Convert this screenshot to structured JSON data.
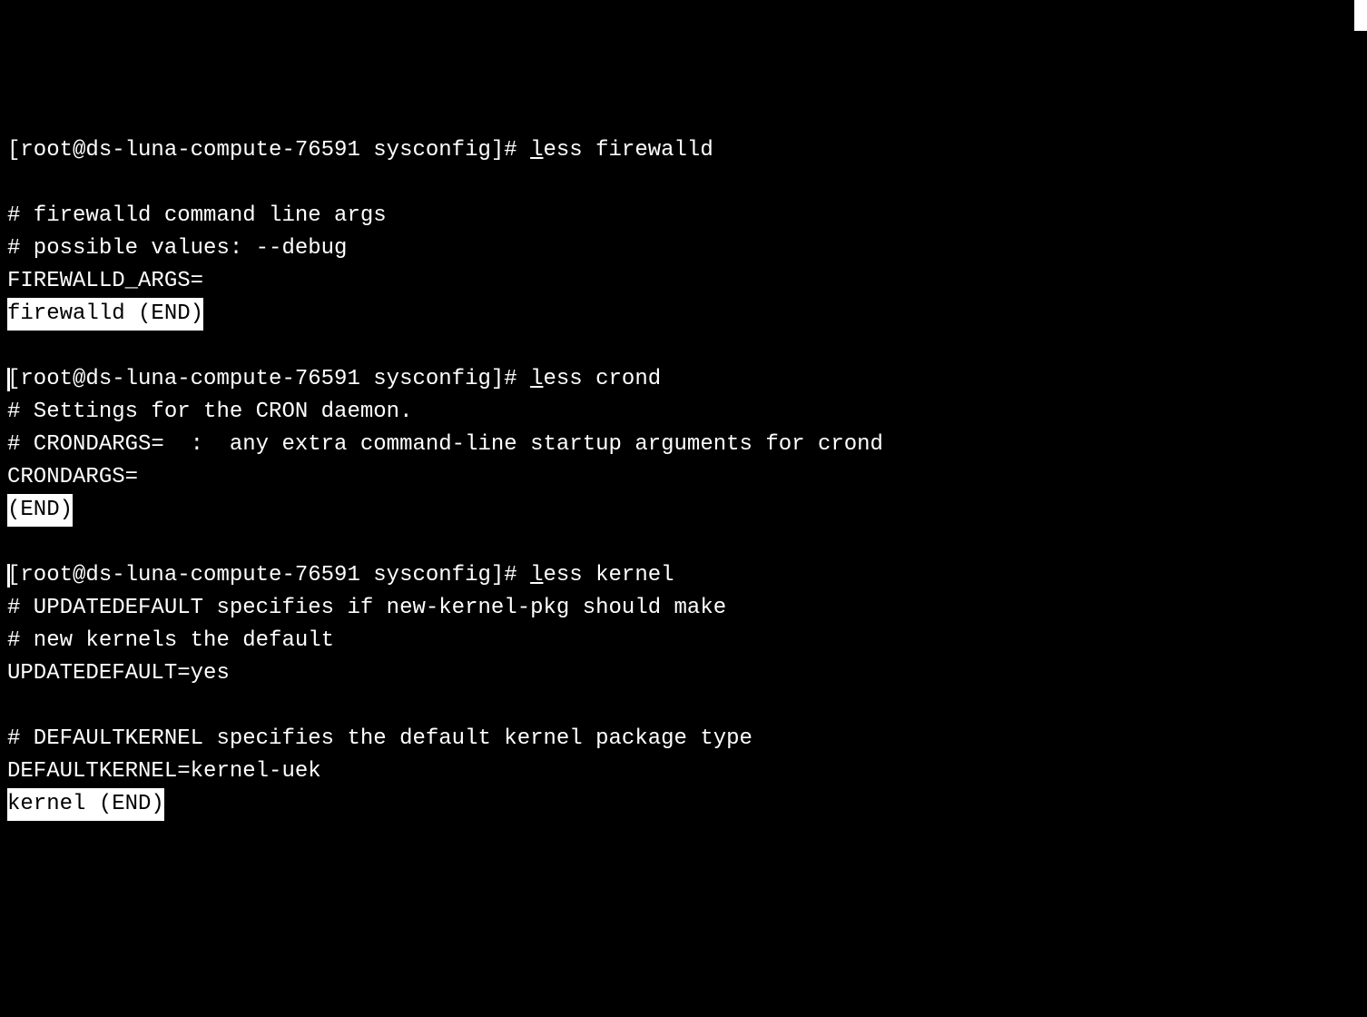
{
  "sessions": [
    {
      "prompt_open": "[root@ds-luna-compute-76591 sysconfig]# ",
      "cmd_pre": "",
      "cmd_u": "l",
      "cmd_post": "ess firewalld",
      "blank_before": true,
      "body": [
        "# firewalld command line args",
        "# possible values: --debug",
        "FIREWALLD_ARGS="
      ],
      "end": "firewalld (END)"
    },
    {
      "prompt_open": "[root@ds-luna-compute-76591 sysconfig]# ",
      "cmd_pre": "",
      "cmd_u": "l",
      "cmd_post": "ess crond",
      "cursor_before": true,
      "body": [
        "# Settings for the CRON daemon.",
        "# CRONDARGS=  :  any extra command-line startup arguments for crond",
        "CRONDARGS="
      ],
      "end": "(END)"
    },
    {
      "prompt_open": "[root@ds-luna-compute-76591 sysconfig]# ",
      "cmd_pre": "",
      "cmd_u": "l",
      "cmd_post": "ess kernel",
      "cursor_before": true,
      "body": [
        "# UPDATEDEFAULT specifies if new-kernel-pkg should make",
        "# new kernels the default",
        "UPDATEDEFAULT=yes",
        "",
        "# DEFAULTKERNEL specifies the default kernel package type",
        "DEFAULTKERNEL=kernel-uek"
      ],
      "end": "kernel (END)"
    }
  ]
}
